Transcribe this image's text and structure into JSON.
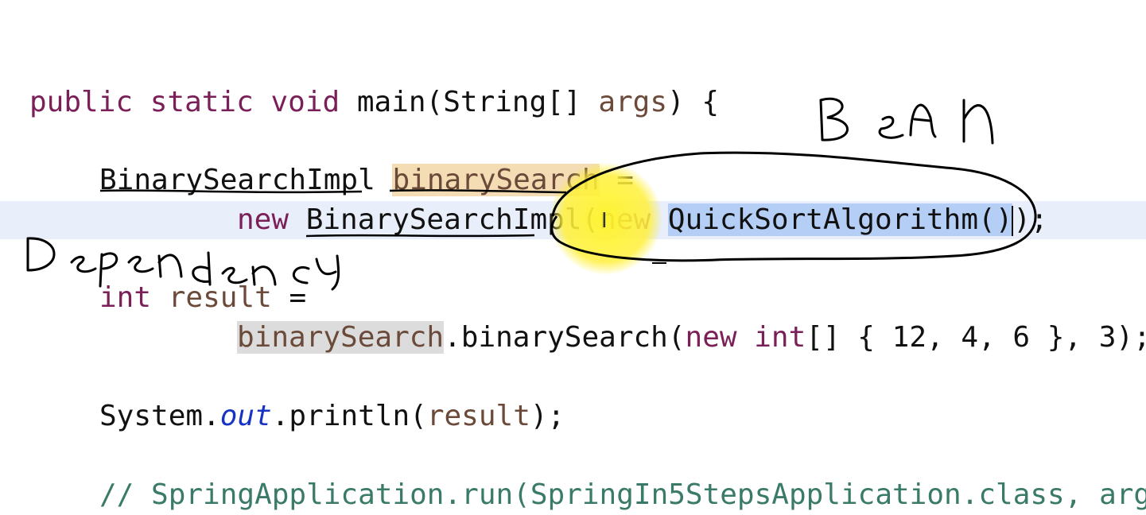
{
  "code": {
    "line1": {
      "kw_public": "public",
      "kw_static": "static",
      "kw_void": "void",
      "signature": "main(String[]",
      "param": "args",
      "close": ") {"
    },
    "line2": {
      "type": "BinarySearchImpl",
      "var": "binarySearch",
      "assign": " ="
    },
    "line3": {
      "kw_new": "new",
      "ctor": " BinarySearchImpl(",
      "kw_new2": "new",
      "selected": "QuickSortAlgorithm()",
      "tail": ");"
    },
    "line4": {
      "kw_int": "int",
      "var": "result",
      "assign": " ="
    },
    "line5": {
      "var": "binarySearch",
      "call": ".binarySearch(",
      "kw_new": "new",
      "kw_int": "int",
      "array": "[] { 12, 4, 6 }, 3);"
    },
    "line6": {
      "system": "System.",
      "field": "out",
      "call": ".println(",
      "arg": "result",
      "close": ");"
    },
    "line7": {
      "comment": "// SpringApplication.run(SpringIn5StepsApplication.class, arg"
    }
  },
  "annotations": {
    "bean_label": "Bean",
    "dependency_label": "Dependency"
  },
  "colors": {
    "keyword": "#7b1f59",
    "field": "#1733c4",
    "comment": "#3a7a68",
    "selection": "#b5cef5",
    "write_highlight": "#f4dcb4",
    "read_highlight": "#dcdcdc",
    "current_line": "#e8eefa",
    "cursor_highlight": "#fff028"
  },
  "icons": {
    "text_cursor": "i-beam-icon"
  }
}
